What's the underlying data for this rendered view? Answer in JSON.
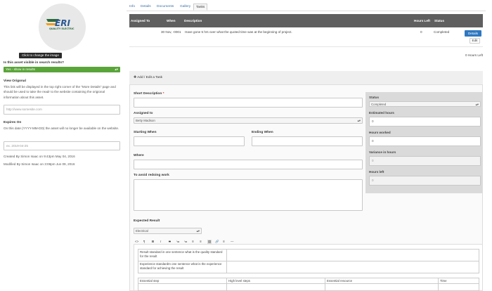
{
  "left": {
    "change_image": "Click to change the image",
    "visible_question": "Is this asset visible in search results?",
    "visible_value": "Yes - show in results",
    "view_original_label": "View Origonal",
    "view_original_desc": "This link will be displayed in the top right corner of the \"More Details\" page and should be used to take the readr to the website containing the origional information about this asset.",
    "url_placeholder": "http://www.somesite.com",
    "expires_label": "Expires On",
    "expires_desc": "On this date (YYYY-MM-DD) the asset will no longer be available on the website.",
    "date_placeholder": "ex. 2019-04-25",
    "created_by": "Created By Simon Isaac on 9:43pm May 04, 2016",
    "modified_by": "Modified By Simon Isaac on 3:08pm Jun 09, 2016"
  },
  "logo": {
    "text": "ERI",
    "sub": "QUALITY ELECTRIC"
  },
  "tabs": [
    "Info",
    "Details",
    "Documents",
    "Gallery",
    "Tasks"
  ],
  "tasks_table": {
    "headers": [
      "Assigned To",
      "When",
      "Description",
      "Hours Left",
      "Status"
    ],
    "row": {
      "when": "30 Nov, -0001",
      "description": "Have gone 5 hrs over what the quoted time was at the beginning of project.",
      "hours_left": "0",
      "status": "Completed",
      "details": "Details",
      "edit": "Edit"
    },
    "hours_left_total": "0 Hours Left"
  },
  "form": {
    "title": "Add / Edit a Task",
    "short_desc_label": "Short Description",
    "assigned_label": "Assigned to",
    "assigned_value": "Betty Madison",
    "starting_label": "Starting When",
    "ending_label": "Ending When",
    "where_label": "Where",
    "avoid_label": "To avoid redoing work",
    "expected_label": "Expected Result",
    "expected_value": "Electrical",
    "status_label": "Status",
    "status_value": "Completed",
    "est_hours_label": "Estimated hours",
    "est_hours_value": "0",
    "hours_worked_label": "Hours worked",
    "hours_worked_value": "0",
    "variance_label": "Variance in hours",
    "variance_value": "0",
    "hours_left_label": "Hours left",
    "hours_left_value": "0"
  },
  "editor": {
    "toolbar": [
      "<>",
      "¶",
      "B",
      "I",
      "S",
      "≔",
      "≔",
      "≡",
      "≡",
      "▤",
      "🔗",
      "≡",
      "—"
    ],
    "table1": [
      "Result standard in one sentence what is the quality standard for the result",
      "Experience standardIn one sentence what is the experience standard for achieving the result"
    ],
    "table2_headers": [
      "Essential step",
      "High level steps",
      "Essential resource",
      "Time"
    ]
  }
}
